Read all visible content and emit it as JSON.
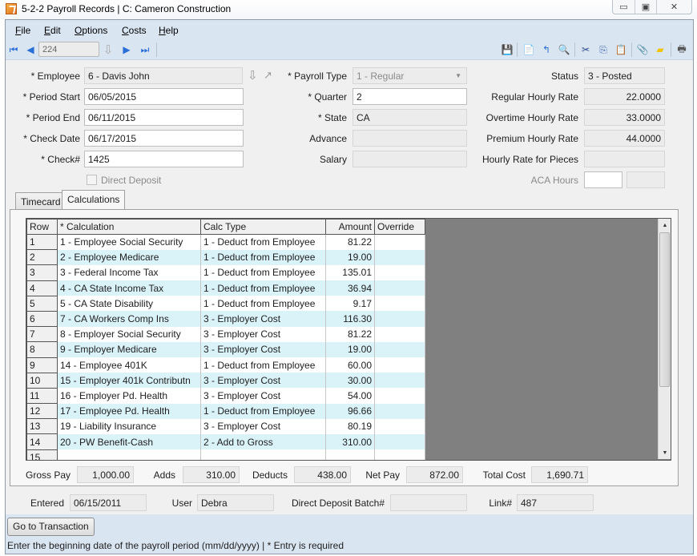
{
  "window": {
    "title": "5-2-2 Payroll Records  |  C: Cameron Construction",
    "controls": {
      "minimize": "▭",
      "maximize": "▣",
      "close": "✕"
    }
  },
  "menu": {
    "items": [
      {
        "label": "File",
        "accel": "F",
        "rest": "ile"
      },
      {
        "label": "Edit",
        "accel": "E",
        "rest": "dit"
      },
      {
        "label": "Options",
        "accel": "O",
        "rest": "ptions"
      },
      {
        "label": "Costs",
        "accel": "C",
        "rest": "osts"
      },
      {
        "label": "Help",
        "accel": "H",
        "rest": "elp"
      }
    ]
  },
  "toolbar": {
    "record_number": "224",
    "nav_icons": {
      "first": "⏮",
      "prev": "◀",
      "lookup": "⇩",
      "next": "▶",
      "last": "⏭"
    },
    "right_icons": {
      "save": "💾",
      "new": "📄",
      "undo": "↰",
      "find": "🔍",
      "cut": "✂",
      "copy": "⎘",
      "paste": "📋",
      "attach": "📎",
      "note": "▰",
      "print": "🖶"
    }
  },
  "form": {
    "employee": {
      "label": "* Employee",
      "value": "6 - Davis John"
    },
    "period_start": {
      "label": "* Period Start",
      "value": "06/05/2015"
    },
    "period_end": {
      "label": "* Period End",
      "value": "06/11/2015"
    },
    "check_date": {
      "label": "* Check Date",
      "value": "06/17/2015"
    },
    "check_no": {
      "label": "* Check#",
      "value": "1425"
    },
    "direct_deposit": {
      "label": "Direct Deposit",
      "checked": false
    },
    "payroll_type": {
      "label": "* Payroll Type",
      "value": "1 - Regular"
    },
    "quarter": {
      "label": "* Quarter",
      "value": "2"
    },
    "state": {
      "label": "* State",
      "value": "CA"
    },
    "advance": {
      "label": "Advance",
      "value": ""
    },
    "salary": {
      "label": "Salary",
      "value": ""
    },
    "status": {
      "label": "Status",
      "value": "3 - Posted"
    },
    "regular_rate": {
      "label": "Regular Hourly Rate",
      "value": "22.0000"
    },
    "overtime_rate": {
      "label": "Overtime Hourly Rate",
      "value": "33.0000"
    },
    "premium_rate": {
      "label": "Premium Hourly Rate",
      "value": "44.0000"
    },
    "pieces_rate": {
      "label": "Hourly Rate for Pieces",
      "value": ""
    },
    "aca_hours": {
      "label": "ACA Hours",
      "value": "",
      "value2": ""
    }
  },
  "tabs": [
    {
      "label": "Timecard",
      "active": false
    },
    {
      "label": "Calculations",
      "active": true
    }
  ],
  "grid": {
    "columns": [
      "Row",
      "* Calculation",
      "Calc Type",
      "Amount",
      "Override"
    ],
    "rows": [
      {
        "row": "1",
        "calc": "1 - Employee Social Security",
        "type": "1 - Deduct from Employee",
        "amount": "81.22",
        "override": ""
      },
      {
        "row": "2",
        "calc": "2 - Employee Medicare",
        "type": "1 - Deduct from Employee",
        "amount": "19.00",
        "override": ""
      },
      {
        "row": "3",
        "calc": "3 - Federal Income Tax",
        "type": "1 - Deduct from Employee",
        "amount": "135.01",
        "override": ""
      },
      {
        "row": "4",
        "calc": "4 - CA State Income Tax",
        "type": "1 - Deduct from Employee",
        "amount": "36.94",
        "override": ""
      },
      {
        "row": "5",
        "calc": "5 - CA State Disability",
        "type": "1 - Deduct from Employee",
        "amount": "9.17",
        "override": ""
      },
      {
        "row": "6",
        "calc": "7 - CA Workers Comp Ins",
        "type": "3 - Employer Cost",
        "amount": "116.30",
        "override": ""
      },
      {
        "row": "7",
        "calc": "8 - Employer Social Security",
        "type": "3 - Employer Cost",
        "amount": "81.22",
        "override": ""
      },
      {
        "row": "8",
        "calc": "9 - Employer Medicare",
        "type": "3 - Employer Cost",
        "amount": "19.00",
        "override": ""
      },
      {
        "row": "9",
        "calc": "14 - Employee 401K",
        "type": "1 - Deduct from Employee",
        "amount": "60.00",
        "override": ""
      },
      {
        "row": "10",
        "calc": "15 - Employer 401k Contributn",
        "type": "3 - Employer Cost",
        "amount": "30.00",
        "override": ""
      },
      {
        "row": "11",
        "calc": "16 - Employer Pd. Health",
        "type": "3 - Employer Cost",
        "amount": "54.00",
        "override": ""
      },
      {
        "row": "12",
        "calc": "17 - Employee Pd. Health",
        "type": "1 - Deduct from Employee",
        "amount": "96.66",
        "override": ""
      },
      {
        "row": "13",
        "calc": "19 - Liability Insurance",
        "type": "3 - Employer Cost",
        "amount": "80.19",
        "override": ""
      },
      {
        "row": "14",
        "calc": "20 - PW Benefit-Cash",
        "type": "2 - Add to Gross",
        "amount": "310.00",
        "override": ""
      },
      {
        "row": "15",
        "calc": "",
        "type": "",
        "amount": "",
        "override": ""
      }
    ],
    "alt_row_color": "#daf3f9"
  },
  "totals": {
    "gross_pay": {
      "label": "Gross Pay",
      "value": "1,000.00"
    },
    "adds": {
      "label": "Adds",
      "value": "310.00"
    },
    "deducts": {
      "label": "Deducts",
      "value": "438.00"
    },
    "net_pay": {
      "label": "Net Pay",
      "value": "872.00"
    },
    "total_cost": {
      "label": "Total Cost",
      "value": "1,690.71"
    }
  },
  "footer": {
    "entered": {
      "label": "Entered",
      "value": "06/15/2011"
    },
    "user": {
      "label": "User",
      "value": "Debra"
    },
    "dd_batch": {
      "label": "Direct Deposit Batch#",
      "value": ""
    },
    "link": {
      "label": "Link#",
      "value": "487"
    },
    "go_button": "Go to Transaction",
    "status_text": "Enter the beginning date of the payroll period (mm/dd/yyyy)  |  * Entry is required"
  }
}
